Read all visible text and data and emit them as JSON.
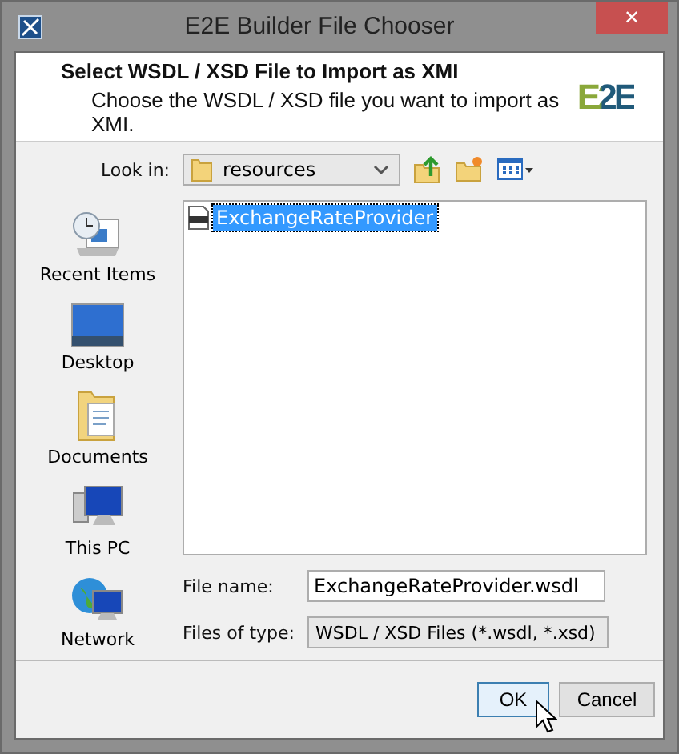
{
  "window": {
    "title": "E2E Builder File Chooser",
    "close": "✕"
  },
  "header": {
    "title": "Select WSDL / XSD File to Import as XMI",
    "subtitle": "Choose the WSDL / XSD file you want to import as XMI.",
    "logo": "E2E"
  },
  "look_in": {
    "label": "Look in:",
    "value": "resources"
  },
  "places": [
    {
      "label": "Recent Items",
      "kind": "recent"
    },
    {
      "label": "Desktop",
      "kind": "desktop"
    },
    {
      "label": "Documents",
      "kind": "documents"
    },
    {
      "label": "This PC",
      "kind": "pc"
    },
    {
      "label": "Network",
      "kind": "network"
    }
  ],
  "files": [
    {
      "name": "ExchangeRateProvider",
      "selected": true
    }
  ],
  "file_name": {
    "label": "File name:",
    "value": "ExchangeRateProvider.wsdl"
  },
  "file_type": {
    "label": "Files of type:",
    "value": "WSDL / XSD Files (*.wsdl, *.xsd)"
  },
  "buttons": [
    {
      "label": "OK",
      "focused": true
    },
    {
      "label": "Cancel",
      "focused": false
    }
  ]
}
